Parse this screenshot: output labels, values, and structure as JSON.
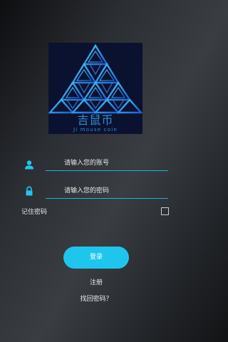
{
  "logo": {
    "chinese_text": "吉鼠币",
    "english_text": "Ji mouse coin",
    "icon": "triangle-pyramid-logo"
  },
  "account_field": {
    "icon": "user-icon",
    "placeholder": "请输入您的账号"
  },
  "password_field": {
    "icon": "lock-icon",
    "placeholder": "请输入您的密码"
  },
  "remember": {
    "label": "记住密码",
    "checked": false
  },
  "login_button": {
    "label": "登录"
  },
  "register_link": {
    "label": "注册"
  },
  "forgot_link": {
    "label": "找回密码？"
  },
  "colors": {
    "accent": "#1ec6ee",
    "underline": "#17b6d9",
    "logo_blue": "#2e8fd6",
    "logo_background": "#0b1230"
  }
}
